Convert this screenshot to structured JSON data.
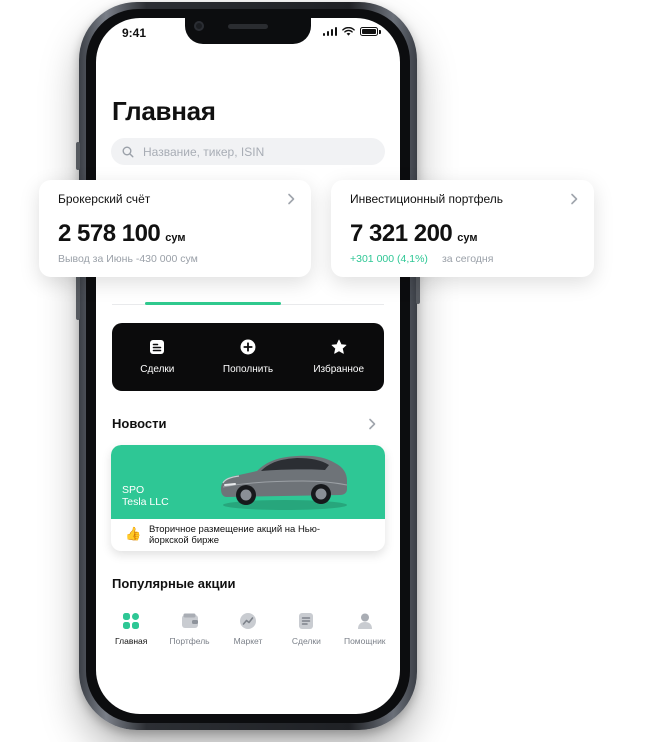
{
  "status": {
    "time": "9:41"
  },
  "home": {
    "title": "Главная",
    "search_placeholder": "Название, тикер, ISIN"
  },
  "brokerage": {
    "title": "Брокерский счёт",
    "amount": "2 578 100",
    "currency": "сум",
    "subtitle": "Вывод за Июнь -430 000 сум"
  },
  "portfolio": {
    "title": "Инвестиционный портфель",
    "amount": "7 321 200",
    "currency": "сум",
    "change": "+301 000 (4,1%)",
    "change_label": "за сегодня"
  },
  "actions": [
    {
      "label": "Сделки",
      "icon": "document-icon"
    },
    {
      "label": "Пополнить",
      "icon": "plus-circle-icon"
    },
    {
      "label": "Избранное",
      "icon": "star-icon"
    }
  ],
  "news": {
    "title": "Новости",
    "tag_line1": "SPO",
    "tag_line2": "Tesla LLC",
    "description": "Вторичное размещение акций на Нью-йоркской бирже",
    "emoji": "👍"
  },
  "popular": {
    "title": "Популярные акции"
  },
  "tabbar": [
    {
      "label": "Главная",
      "icon": "home-grid-icon",
      "active": true
    },
    {
      "label": "Портфель",
      "icon": "wallet-icon",
      "active": false
    },
    {
      "label": "Маркет",
      "icon": "chart-icon",
      "active": false
    },
    {
      "label": "Сделки",
      "icon": "list-icon",
      "active": false
    },
    {
      "label": "Помощник",
      "icon": "user-icon",
      "active": false
    }
  ],
  "colors": {
    "accent": "#2ec795",
    "dark": "#0b0b0c"
  }
}
